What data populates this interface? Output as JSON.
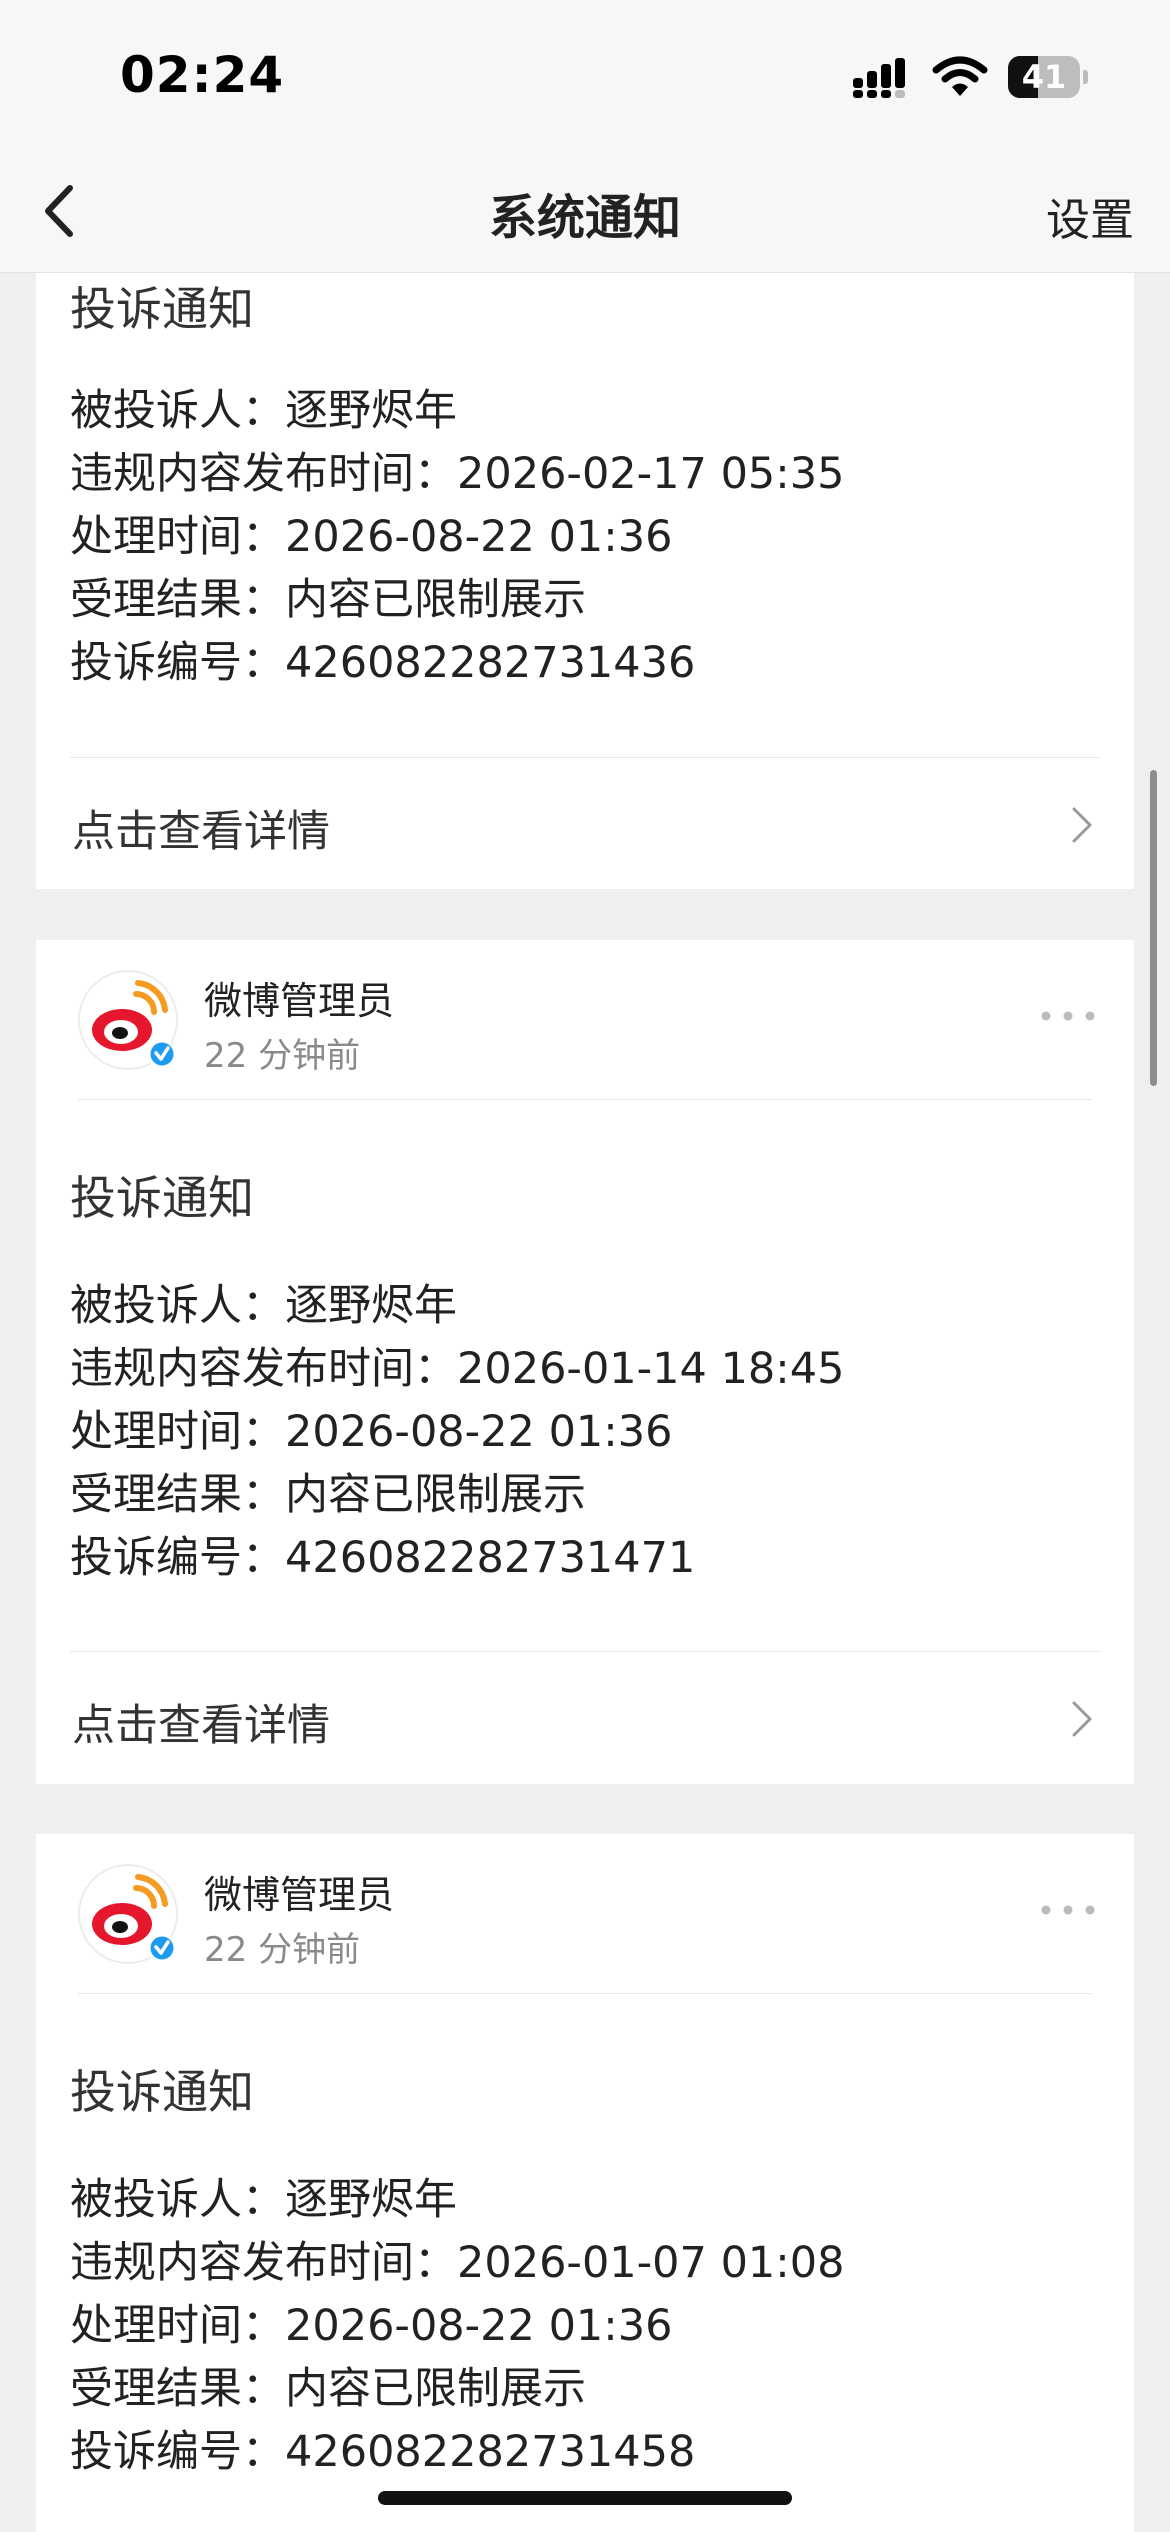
{
  "status_bar": {
    "time": "02:24",
    "battery_level": "41",
    "battery_fraction": 0.41
  },
  "nav": {
    "title": "系统通知",
    "settings_label": "设置",
    "back_icon": "chevron-left-icon"
  },
  "colors": {
    "weibo_red": "#e6162d",
    "weibo_orange": "#f59b22",
    "verified_blue": "#1d9bf0"
  },
  "cards": [
    {
      "notice_title": "投诉通知",
      "lines": [
        {
          "label": "被投诉人：",
          "value": "逐野烬年"
        },
        {
          "label": "违规内容发布时间：",
          "value": "2026-02-17 05:35"
        },
        {
          "label": "处理时间：",
          "value": "2026-08-22 01:36"
        },
        {
          "label": "受理结果：",
          "value": "内容已限制展示"
        },
        {
          "label": "投诉编号：",
          "value": "426082282731436"
        }
      ],
      "view_detail_label": "点击查看详情"
    },
    {
      "author": "微博管理员",
      "time": "22 分钟前",
      "notice_title": "投诉通知",
      "lines": [
        {
          "label": "被投诉人：",
          "value": "逐野烬年"
        },
        {
          "label": "违规内容发布时间：",
          "value": "2026-01-14 18:45"
        },
        {
          "label": "处理时间：",
          "value": "2026-08-22 01:36"
        },
        {
          "label": "受理结果：",
          "value": "内容已限制展示"
        },
        {
          "label": "投诉编号：",
          "value": "426082282731471"
        }
      ],
      "view_detail_label": "点击查看详情"
    },
    {
      "author": "微博管理员",
      "time": "22 分钟前",
      "notice_title": "投诉通知",
      "lines": [
        {
          "label": "被投诉人：",
          "value": "逐野烬年"
        },
        {
          "label": "违规内容发布时间：",
          "value": "2026-01-07 01:08"
        },
        {
          "label": "处理时间：",
          "value": "2026-08-22 01:36"
        },
        {
          "label": "受理结果：",
          "value": "内容已限制展示"
        },
        {
          "label": "投诉编号：",
          "value": "426082282731458"
        }
      ]
    }
  ]
}
